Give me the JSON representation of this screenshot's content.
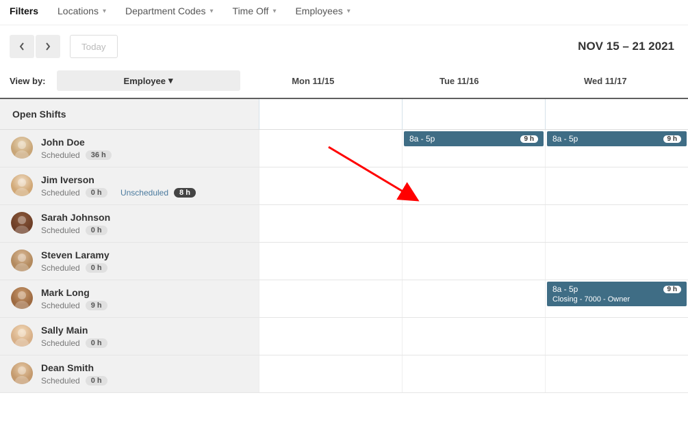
{
  "filters": {
    "label": "Filters",
    "items": [
      "Locations",
      "Department Codes",
      "Time Off",
      "Employees"
    ]
  },
  "toolbar": {
    "today": "Today",
    "date_range": "NOV 15 – 21 2021"
  },
  "viewby": {
    "label": "View by:",
    "selected": "Employee"
  },
  "days": [
    "Mon 11/15",
    "Tue 11/16",
    "Wed 11/17"
  ],
  "open_shifts_label": "Open Shifts",
  "scheduled_label": "Scheduled",
  "unscheduled_label": "Unscheduled",
  "employees": [
    {
      "name": "John Doe",
      "scheduled": "36 h",
      "shifts": [
        {
          "day": 1,
          "time": "8a - 5p",
          "hours": "9 h"
        },
        {
          "day": 2,
          "time": "8a - 5p",
          "hours": "9 h"
        }
      ]
    },
    {
      "name": "Jim Iverson",
      "scheduled": "0 h",
      "unscheduled": "8 h",
      "shifts": []
    },
    {
      "name": "Sarah Johnson",
      "scheduled": "0 h",
      "shifts": []
    },
    {
      "name": "Steven Laramy",
      "scheduled": "0 h",
      "shifts": []
    },
    {
      "name": "Mark Long",
      "scheduled": "9 h",
      "shifts": [
        {
          "day": 2,
          "time": "8a - 5p",
          "hours": "9 h",
          "detail": "Closing - 7000 - Owner"
        }
      ]
    },
    {
      "name": "Sally Main",
      "scheduled": "0 h",
      "shifts": []
    },
    {
      "name": "Dean Smith",
      "scheduled": "0 h",
      "shifts": []
    }
  ],
  "avatar_colors": [
    [
      "#e8d5b5",
      "#c9a678"
    ],
    [
      "#f0ddc5",
      "#d1a876"
    ],
    [
      "#8b5a3c",
      "#6e3f28"
    ],
    [
      "#d9b896",
      "#b38a5e"
    ],
    [
      "#c99a6e",
      "#9e6b42"
    ],
    [
      "#f2d9b8",
      "#d8b088"
    ],
    [
      "#e6c9a6",
      "#c49a6e"
    ]
  ]
}
